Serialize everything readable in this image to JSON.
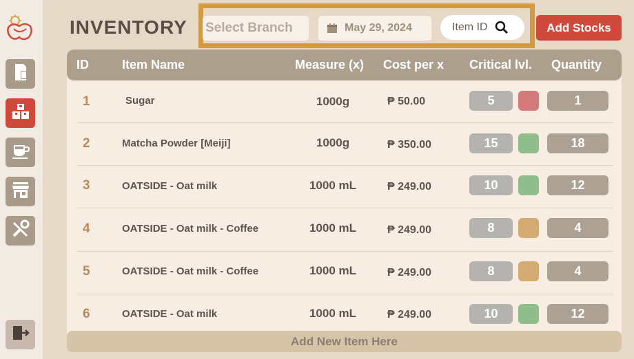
{
  "page": {
    "title": "INVENTORY"
  },
  "sidebar": {
    "items": [
      {
        "name": "orders",
        "icon": "document-icon",
        "active": false
      },
      {
        "name": "inventory",
        "icon": "boxes-icon",
        "active": true
      },
      {
        "name": "menu",
        "icon": "coffee-cup-icon",
        "active": false
      },
      {
        "name": "branches",
        "icon": "store-icon",
        "active": false
      },
      {
        "name": "settings",
        "icon": "tools-icon",
        "active": false
      }
    ],
    "logout_icon": "logout-icon"
  },
  "filters": {
    "branch_placeholder": "Select Branch",
    "date": "May 29, 2024",
    "item_search_label": "Item ID"
  },
  "actions": {
    "add_stocks": "Add Stocks",
    "add_new_item": "Add New Item Here"
  },
  "table": {
    "headers": {
      "id": "ID",
      "name": "Item Name",
      "measure": "Measure (x)",
      "cost": "Cost per x",
      "critical": "Critical lvl.",
      "quantity": "Quantity"
    },
    "rows": [
      {
        "id": "1",
        "name": "Sugar",
        "measure": "1000g",
        "cost": "₱ 50.00",
        "critical": "5",
        "quantity": "1",
        "status_color": "#d4797a"
      },
      {
        "id": "2",
        "name": "Matcha Powder [Meiji]",
        "measure": "1000g",
        "cost": "₱ 350.00",
        "critical": "15",
        "quantity": "18",
        "status_color": "#8fbd8c"
      },
      {
        "id": "3",
        "name": "OATSIDE - Oat milk",
        "measure": "1000 mL",
        "cost": "₱ 249.00",
        "critical": "10",
        "quantity": "12",
        "status_color": "#8fbd8c"
      },
      {
        "id": "4",
        "name": "OATSIDE - Oat milk - Coffee",
        "measure": "1000 mL",
        "cost": "₱ 249.00",
        "critical": "8",
        "quantity": "4",
        "status_color": "#d3aa72"
      },
      {
        "id": "5",
        "name": "OATSIDE - Oat milk - Coffee",
        "measure": "1000 mL",
        "cost": "₱ 249.00",
        "critical": "8",
        "quantity": "4",
        "status_color": "#d3aa72"
      },
      {
        "id": "6",
        "name": "OATSIDE - Oat milk",
        "measure": "1000 mL",
        "cost": "₱ 249.00",
        "critical": "10",
        "quantity": "12",
        "status_color": "#8fbd8c"
      }
    ]
  },
  "colors": {
    "accent": "#cf4a3c",
    "highlight_border": "#d39a3f",
    "header_bg": "#ac9f8d"
  }
}
